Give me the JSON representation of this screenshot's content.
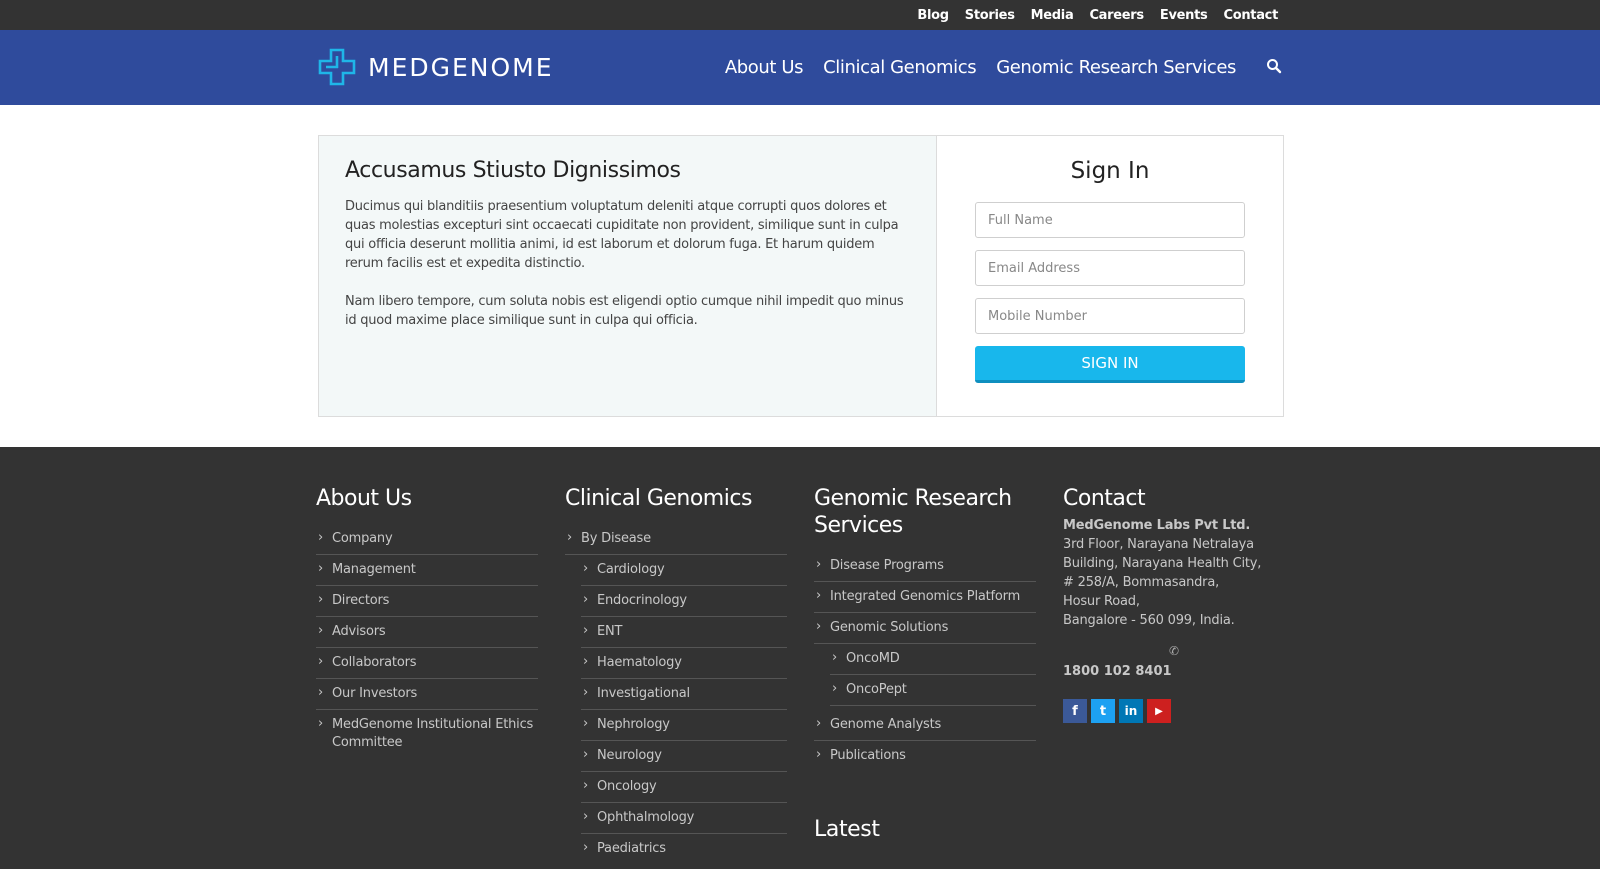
{
  "topnav": [
    "Blog",
    "Stories",
    "Media",
    "Careers",
    "Events",
    "Contact"
  ],
  "brand": {
    "name": "MEDGENOME",
    "accent": "#2f4b9c",
    "logo_color": "#1fb6e8"
  },
  "mainnav": [
    "About Us",
    "Clinical Genomics",
    "Genomic Research Services"
  ],
  "search": {
    "icon": "search-icon"
  },
  "intro": {
    "title": "Accusamus Stiusto Dignissimos",
    "p1": "Ducimus qui blanditiis praesentium voluptatum deleniti atque corrupti quos dolores et quas molestias excepturi sint occaecati cupiditate non provident, similique sunt in culpa qui officia deserunt mollitia animi, id est laborum et dolorum fuga. Et harum quidem rerum facilis est et expedita distinctio.",
    "p2": "Nam libero tempore, cum soluta nobis est eligendi optio cumque nihil impedit quo minus id quod maxime place similique sunt in culpa qui officia."
  },
  "signin": {
    "title": "Sign In",
    "name_placeholder": "Full Name",
    "email_placeholder": "Email Address",
    "mobile_placeholder": "Mobile Number",
    "button": "SIGN IN",
    "button_color": "#18b7ec"
  },
  "footer": {
    "about": {
      "title": "About Us",
      "items": [
        "Company",
        "Management",
        "Directors",
        "Advisors",
        "Collaborators",
        "Our Investors",
        "MedGenome Institutional Ethics Committee"
      ]
    },
    "clinical": {
      "title": "Clinical Genomics",
      "top": "By Disease",
      "items": [
        "Cardiology",
        "Endocrinology",
        "ENT",
        "Haematology",
        "Investigational",
        "Nephrology",
        "Neurology",
        "Oncology",
        "Ophthalmology",
        "Paediatrics"
      ]
    },
    "research": {
      "title": "Genomic Research Services",
      "items": [
        "Disease Programs",
        "Integrated Genomics Platform",
        "Genomic Solutions"
      ],
      "sub": [
        "OncoMD",
        "OncoPept"
      ],
      "items2": [
        "Genome Analysts",
        "Publications"
      ]
    },
    "contact": {
      "title": "Contact",
      "company": "MedGenome Labs Pvt Ltd.",
      "address": [
        "3rd Floor, Narayana Netralaya",
        "Building, Narayana Health City,",
        "# 258/A, Bommasandra,",
        "Hosur Road,",
        "Bangalore - 560 099, India."
      ],
      "phone": "1800 102 8401",
      "socials": [
        {
          "name": "facebook-icon",
          "glyph": "f",
          "color": "#3b5998"
        },
        {
          "name": "twitter-icon",
          "glyph": "t",
          "color": "#1da1f2"
        },
        {
          "name": "linkedin-icon",
          "glyph": "in",
          "color": "#0077b5"
        },
        {
          "name": "youtube-icon",
          "glyph": "▶",
          "color": "#cd201f"
        }
      ]
    },
    "latest": "Latest"
  }
}
